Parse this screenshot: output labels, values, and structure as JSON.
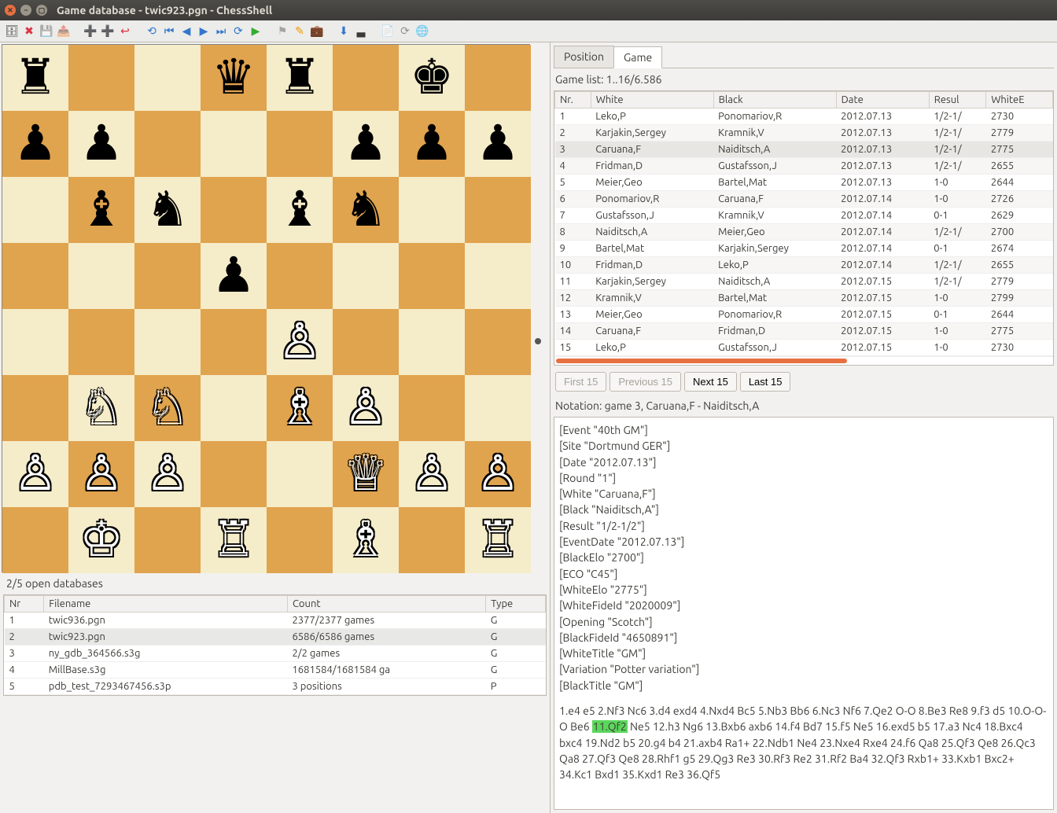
{
  "window": {
    "title": "Game database - twic923.pgn - ChessShell"
  },
  "toolbar_icons": [
    "db",
    "del",
    "save",
    "export",
    "add",
    "add2",
    "exit",
    "",
    "first",
    "back",
    "prev",
    "next",
    "fwd",
    "last",
    "play",
    "",
    "flag",
    "pencil",
    "suit",
    "",
    "dl",
    "term",
    "",
    "doc",
    "refresh",
    "globe"
  ],
  "board": {
    "fen": "r2qr1k1/pp3ppp/1bn1bn2/3p4/4P3/1NN1BP2/PPP2QPP/1K1R1B1R",
    "squares": [
      [
        {
          "p": "r",
          "c": "b"
        },
        null,
        null,
        {
          "p": "q",
          "c": "b"
        },
        {
          "p": "r",
          "c": "b"
        },
        null,
        {
          "p": "k",
          "c": "b"
        },
        null
      ],
      [
        {
          "p": "p",
          "c": "b"
        },
        {
          "p": "p",
          "c": "b"
        },
        null,
        null,
        null,
        {
          "p": "p",
          "c": "b"
        },
        {
          "p": "p",
          "c": "b"
        },
        {
          "p": "p",
          "c": "b"
        }
      ],
      [
        null,
        {
          "p": "b",
          "c": "b"
        },
        {
          "p": "n",
          "c": "b"
        },
        null,
        {
          "p": "b",
          "c": "b"
        },
        {
          "p": "n",
          "c": "b"
        },
        null,
        null
      ],
      [
        null,
        null,
        null,
        {
          "p": "p",
          "c": "b"
        },
        null,
        null,
        null,
        null
      ],
      [
        null,
        null,
        null,
        null,
        {
          "p": "p",
          "c": "w"
        },
        null,
        null,
        null
      ],
      [
        null,
        {
          "p": "n",
          "c": "w"
        },
        {
          "p": "n",
          "c": "w"
        },
        null,
        {
          "p": "b",
          "c": "w"
        },
        {
          "p": "p",
          "c": "w"
        },
        null,
        null
      ],
      [
        {
          "p": "p",
          "c": "w"
        },
        {
          "p": "p",
          "c": "w"
        },
        {
          "p": "p",
          "c": "w"
        },
        null,
        null,
        {
          "p": "q",
          "c": "w"
        },
        {
          "p": "p",
          "c": "w"
        },
        {
          "p": "p",
          "c": "w"
        }
      ],
      [
        null,
        {
          "p": "k",
          "c": "w"
        },
        null,
        {
          "p": "r",
          "c": "w"
        },
        null,
        {
          "p": "b",
          "c": "w"
        },
        null,
        {
          "p": "r",
          "c": "w"
        }
      ]
    ]
  },
  "db_panel": {
    "caption": "2/5 open databases",
    "headers": [
      "Nr",
      "Filename",
      "Count",
      "Type"
    ],
    "rows": [
      {
        "nr": "1",
        "file": "twic936.pgn",
        "count": "2377/2377 games",
        "type": "G",
        "sel": false
      },
      {
        "nr": "2",
        "file": "twic923.pgn",
        "count": "6586/6586 games",
        "type": "G",
        "sel": true
      },
      {
        "nr": "3",
        "file": "ny_gdb_364566.s3g",
        "count": "2/2 games",
        "type": "G",
        "sel": false
      },
      {
        "nr": "4",
        "file": "MillBase.s3g",
        "count": "1681584/1681584 ga",
        "type": "G",
        "sel": false
      },
      {
        "nr": "5",
        "file": "pdb_test_7293467456.s3p",
        "count": "3 positions",
        "type": "P",
        "sel": false
      }
    ]
  },
  "right": {
    "tabs": {
      "position": "Position",
      "game": "Game"
    },
    "game_list_caption": "Game list: 1..16/6.586",
    "headers": [
      "Nr.",
      "White",
      "Black",
      "Date",
      "Resul",
      "WhiteE"
    ],
    "games": [
      {
        "nr": "1",
        "w": "Leko,P",
        "b": "Ponomariov,R",
        "d": "2012.07.13",
        "r": "1/2-1/",
        "we": "2730",
        "sel": false
      },
      {
        "nr": "2",
        "w": "Karjakin,Sergey",
        "b": "Kramnik,V",
        "d": "2012.07.13",
        "r": "1/2-1/",
        "we": "2779",
        "sel": false
      },
      {
        "nr": "3",
        "w": "Caruana,F",
        "b": "Naiditsch,A",
        "d": "2012.07.13",
        "r": "1/2-1/",
        "we": "2775",
        "sel": true
      },
      {
        "nr": "4",
        "w": "Fridman,D",
        "b": "Gustafsson,J",
        "d": "2012.07.13",
        "r": "1/2-1/",
        "we": "2655",
        "sel": false
      },
      {
        "nr": "5",
        "w": "Meier,Geo",
        "b": "Bartel,Mat",
        "d": "2012.07.13",
        "r": "1-0",
        "we": "2644",
        "sel": false
      },
      {
        "nr": "6",
        "w": "Ponomariov,R",
        "b": "Caruana,F",
        "d": "2012.07.14",
        "r": "1-0",
        "we": "2726",
        "sel": false
      },
      {
        "nr": "7",
        "w": "Gustafsson,J",
        "b": "Kramnik,V",
        "d": "2012.07.14",
        "r": "0-1",
        "we": "2629",
        "sel": false
      },
      {
        "nr": "8",
        "w": "Naiditsch,A",
        "b": "Meier,Geo",
        "d": "2012.07.14",
        "r": "1/2-1/",
        "we": "2700",
        "sel": false
      },
      {
        "nr": "9",
        "w": "Bartel,Mat",
        "b": "Karjakin,Sergey",
        "d": "2012.07.14",
        "r": "0-1",
        "we": "2674",
        "sel": false
      },
      {
        "nr": "10",
        "w": "Fridman,D",
        "b": "Leko,P",
        "d": "2012.07.14",
        "r": "1/2-1/",
        "we": "2655",
        "sel": false
      },
      {
        "nr": "11",
        "w": "Karjakin,Sergey",
        "b": "Naiditsch,A",
        "d": "2012.07.15",
        "r": "1/2-1/",
        "we": "2779",
        "sel": false
      },
      {
        "nr": "12",
        "w": "Kramnik,V",
        "b": "Bartel,Mat",
        "d": "2012.07.15",
        "r": "1-0",
        "we": "2799",
        "sel": false
      },
      {
        "nr": "13",
        "w": "Meier,Geo",
        "b": "Ponomariov,R",
        "d": "2012.07.15",
        "r": "0-1",
        "we": "2644",
        "sel": false
      },
      {
        "nr": "14",
        "w": "Caruana,F",
        "b": "Fridman,D",
        "d": "2012.07.15",
        "r": "1-0",
        "we": "2775",
        "sel": false
      },
      {
        "nr": "15",
        "w": "Leko,P",
        "b": "Gustafsson,J",
        "d": "2012.07.15",
        "r": "1-0",
        "we": "2730",
        "sel": false
      }
    ],
    "pager": {
      "first": "First 15",
      "prev": "Previous 15",
      "next": "Next 15",
      "last": "Last 15"
    },
    "notation_caption": "Notation: game 3, Caruana,F - Naiditsch,A",
    "headers_pgn": [
      "[Event \"40th GM\"]",
      "[Site \"Dortmund GER\"]",
      "[Date \"2012.07.13\"]",
      "[Round \"1\"]",
      "[White \"Caruana,F\"]",
      "[Black \"Naiditsch,A\"]",
      "[Result \"1/2-1/2\"]",
      "[EventDate \"2012.07.13\"]",
      "[BlackElo \"2700\"]",
      "[ECO \"C45\"]",
      "[WhiteElo \"2775\"]",
      "[WhiteFideId \"2020009\"]",
      "[Opening \"Scotch\"]",
      "[BlackFideId \"4650891\"]",
      "[WhiteTitle \"GM\"]",
      "[Variation \"Potter variation\"]",
      "[BlackTitle \"GM\"]"
    ],
    "moves_pre": "1.e4 e5 2.Nf3 Nc6 3.d4 exd4 4.Nxd4 Bc5 5.Nb3 Bb6 6.Nc3 Nf6 7.Qe2 O-O 8.Be3 Re8 9.f3 d5 10.O-O-O Be6 ",
    "moves_hl": "11.Qf2",
    "moves_post": " Ne5 12.h3 Ng6 13.Bxb6 axb6 14.f4 Bd7 15.f5 Ne5 16.exd5 b5 17.a3 Nc4 18.Bxc4 bxc4 19.Nd2 b5 20.g4 b4 21.axb4 Ra1+ 22.Ndb1 Ne4 23.Nxe4 Rxe4 24.f6 Qa8 25.Qf3 Qe8 26.Qc3 Qa8 27.Qf3 Qe8 28.Rhf1 g5 29.Qg3 Re3 30.Rf3 Re2 31.Rf2 Ba4 32.Qf3 Rxb1+ 33.Kxb1 Bxc2+ 34.Kc1 Bxd1 35.Kxd1 Re3 36.Qf5"
  }
}
